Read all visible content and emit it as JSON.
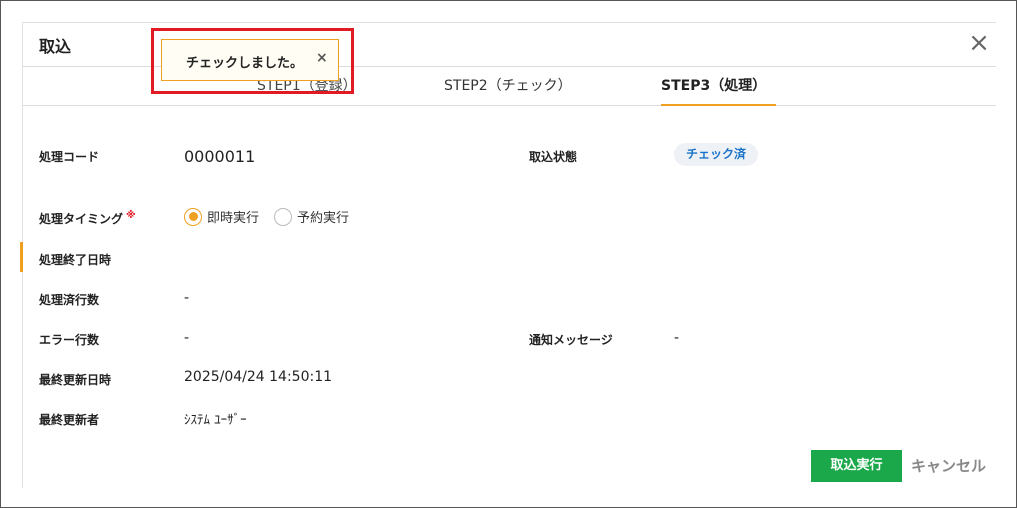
{
  "dialog": {
    "title": "取込",
    "close_icon": "×"
  },
  "toast": {
    "message": "チェックしました。",
    "close_icon": "×"
  },
  "tabs": [
    {
      "label": "STEP1（登録）"
    },
    {
      "label": "STEP2（チェック）"
    },
    {
      "label": "STEP3（処理）",
      "active": true
    }
  ],
  "fields": {
    "process_code": {
      "label": "処理コード",
      "value": "0000011"
    },
    "import_status": {
      "label": "取込状態",
      "value": "チェック済"
    },
    "timing": {
      "label": "処理タイミング",
      "required_mark": "※",
      "options": [
        "即時実行",
        "予約実行"
      ],
      "selected": "即時実行"
    },
    "end_datetime": {
      "label": "処理終了日時",
      "value": ""
    },
    "processed_rows": {
      "label": "処理済行数",
      "value": "-"
    },
    "error_rows": {
      "label": "エラー行数",
      "value": "-"
    },
    "notify_message": {
      "label": "通知メッセージ",
      "value": "-"
    },
    "last_updated": {
      "label": "最終更新日時",
      "value": "2025/04/24 14:50:11"
    },
    "last_updated_by": {
      "label": "最終更新者",
      "value": "ｼｽﾃﾑ ﾕｰｻﾞｰ"
    }
  },
  "actions": {
    "execute_label": "取込実行",
    "cancel_label": "キャンセル"
  },
  "colors": {
    "accent": "#f0a020",
    "primary_button": "#1aa84a",
    "badge_text": "#1a73c8",
    "highlight": "#e01b24"
  }
}
